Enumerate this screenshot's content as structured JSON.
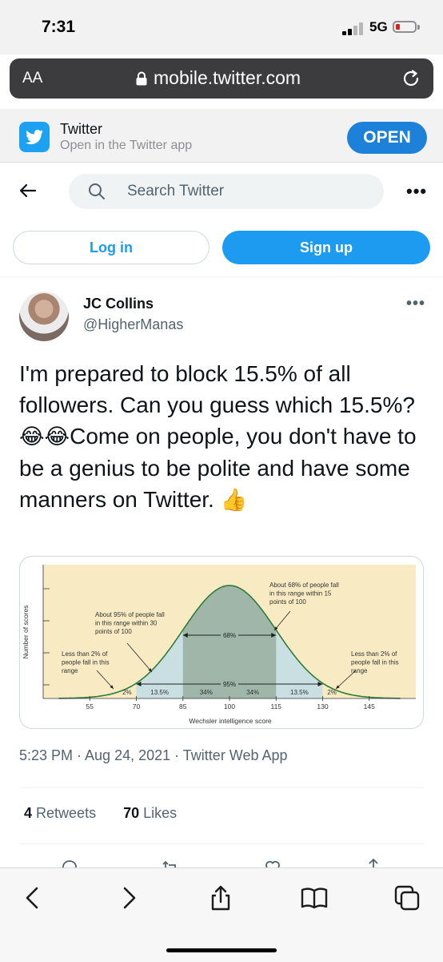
{
  "status_bar": {
    "time": "7:31",
    "network": "5G"
  },
  "browser": {
    "text_size_label": "AA",
    "url": "mobile.twitter.com"
  },
  "app_banner": {
    "title": "Twitter",
    "subtitle": "Open in the Twitter app",
    "open_label": "OPEN"
  },
  "header": {
    "search_placeholder": "Search Twitter"
  },
  "auth": {
    "login_label": "Log in",
    "signup_label": "Sign up"
  },
  "tweet": {
    "author_name": "JC Collins",
    "author_handle": "@HigherManas",
    "text_part1": "I'm prepared to block 15.5% of all followers. Can you guess which 15.5%? ",
    "emoji_1": "😂😂",
    "text_part2": "Come on people, you don't have to be a genius to be polite and have some manners on Twitter. ",
    "emoji_2": "👍",
    "timestamp": "5:23 PM · Aug 24, 2021 · Twitter Web App",
    "retweets_count": "4",
    "retweets_label": "Retweets",
    "likes_count": "70",
    "likes_label": "Likes"
  },
  "chart_data": {
    "type": "area",
    "xlabel": "Wechsler intelligence score",
    "ylabel": "Number of scores",
    "x_ticks": [
      "55",
      "70",
      "85",
      "100",
      "115",
      "130",
      "145"
    ],
    "x": [
      55,
      70,
      85,
      100,
      115,
      130,
      145
    ],
    "distribution": {
      "mean": 100,
      "sd": 15
    },
    "band_percentages": [
      "2%",
      "13.5%",
      "34%",
      "34%",
      "13.5%",
      "2%"
    ],
    "range_labels": {
      "inner": "68%",
      "outer": "95%"
    },
    "annotations": {
      "top": "About 68% of people fall in this range within 15 points of 100",
      "mid": "About 95% of people fall in this range within 30 points of 100",
      "left": "Less than 2% of people fall in this range",
      "right": "Less than 2% of people fall in this range"
    },
    "colors": {
      "background": "#f8ebc4",
      "inner_band": "#9fb6a9",
      "outer_band": "#c9dfe1",
      "curve": "#2f7d3a"
    }
  },
  "colors": {
    "twitter_blue": "#1d9bf0",
    "banner_button": "#1d81d9",
    "url_bar": "#3c3c3e"
  }
}
